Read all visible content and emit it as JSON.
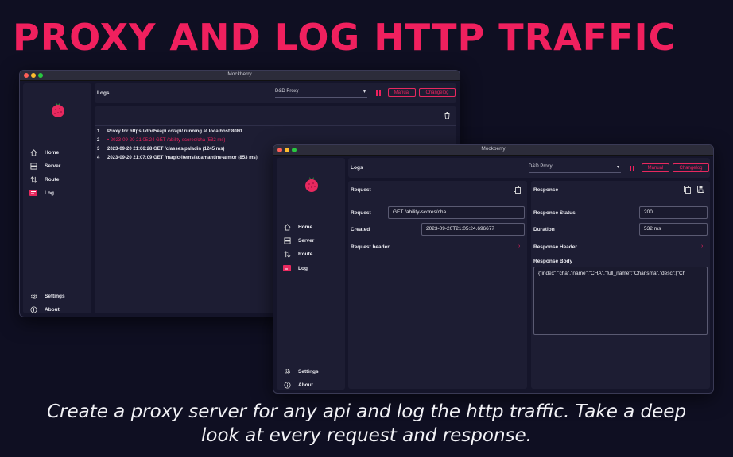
{
  "headline": "PROXY AND LOG HTTP TRAFFIC",
  "caption": "Create a proxy server for any api and log the http traffic. Take a deep look at every request and response.",
  "colors": {
    "accent": "#f0205e",
    "background": "#0f0f22",
    "panel": "#1d1d33"
  },
  "app_name": "Mockberry",
  "sidebar": {
    "items": [
      {
        "label": "Home",
        "icon": "home-icon"
      },
      {
        "label": "Server",
        "icon": "server-icon"
      },
      {
        "label": "Route",
        "icon": "route-icon"
      },
      {
        "label": "Log",
        "icon": "log-icon"
      }
    ],
    "bottom": [
      {
        "label": "Settings",
        "icon": "gear-icon"
      },
      {
        "label": "About",
        "icon": "info-icon"
      }
    ]
  },
  "toolbar": {
    "title": "Logs",
    "proxy_select": "D&D Proxy",
    "manual_label": "Manual",
    "changelog_label": "Changelog"
  },
  "logs": [
    {
      "num": "1",
      "text": "Proxy for https://dnd5eapi.co/api/ running at localhost:8080"
    },
    {
      "num": "2",
      "text": "• 2023-09-20 21:05:24 GET /ability-scores/cha (532 ms)"
    },
    {
      "num": "3",
      "text": "2023-09-20 21:06:28 GET /classes/paladin (1245 ms)"
    },
    {
      "num": "4",
      "text": "2023-09-20 21:07:09 GET /magic-items/adamantine-armor (853 ms)"
    }
  ],
  "request": {
    "title": "Request",
    "request_label": "Request",
    "request_value": "GET /ability-scores/cha",
    "created_label": "Created",
    "created_value": "2023-09-20T21:05:24.696677",
    "header_label": "Request header"
  },
  "response": {
    "title": "Response",
    "status_label": "Response Status",
    "status_value": "200",
    "duration_label": "Duration",
    "duration_value": "532 ms",
    "header_label": "Response Header",
    "body_label": "Response Body",
    "body_value": "{\"index\":\"cha\",\"name\":\"CHA\",\"full_name\":\"Charisma\",\"desc\":[\"Ch"
  }
}
